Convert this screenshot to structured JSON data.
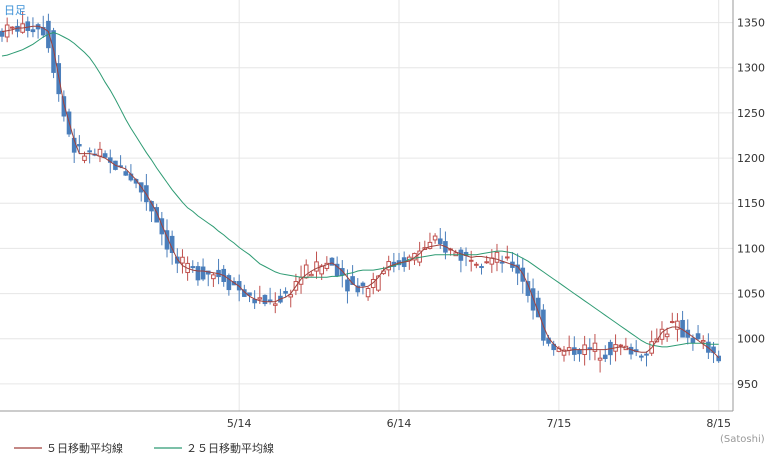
{
  "period_label": "日足",
  "unit_label": "(Satoshi)",
  "colors": {
    "plot_background": "#ffffff",
    "grid": "#e6e6e6",
    "axis": "#999999",
    "label": "#333333",
    "period_label": "#3a8fd6",
    "candle_down": "#4a7ebb",
    "candle_up": "#ffffff",
    "candle_up_outline": "#c0504d",
    "ma5": "#a0413c",
    "ma25": "#2e9b73"
  },
  "chart_data": {
    "type": "candlestick",
    "x_ticks": [
      {
        "label": "5/14",
        "index": 46
      },
      {
        "label": "6/14",
        "index": 77
      },
      {
        "label": "7/15",
        "index": 108
      },
      {
        "label": "8/15",
        "index": 139
      }
    ],
    "y_ticks": [
      950,
      1000,
      1050,
      1100,
      1150,
      1200,
      1250,
      1300,
      1350
    ],
    "ylim": [
      920,
      1375
    ],
    "x_range": [
      0,
      141
    ],
    "legend": [
      {
        "name": "５日移動平均線",
        "color": "#a0413c"
      },
      {
        "name": "２５日移動平均線",
        "color": "#2e9b73"
      }
    ],
    "series": {
      "ma5": [
        1340,
        1341,
        1342,
        1344,
        1344,
        1345,
        1346,
        1346,
        1344,
        1340,
        1320,
        1290,
        1260,
        1240,
        1220,
        1205,
        1205,
        1205,
        1204,
        1202,
        1200,
        1196,
        1192,
        1190,
        1188,
        1182,
        1176,
        1168,
        1160,
        1150,
        1140,
        1126,
        1113,
        1100,
        1088,
        1081,
        1078,
        1076,
        1075,
        1075,
        1074,
        1073,
        1072,
        1070,
        1066,
        1062,
        1058,
        1052,
        1047,
        1044,
        1042,
        1041,
        1041,
        1041,
        1044,
        1046,
        1050,
        1058,
        1066,
        1071,
        1075,
        1078,
        1080,
        1082,
        1084,
        1080,
        1075,
        1068,
        1061,
        1057,
        1057,
        1058,
        1062,
        1068,
        1076,
        1080,
        1082,
        1084,
        1085,
        1086,
        1090,
        1094,
        1100,
        1102,
        1103,
        1104,
        1102,
        1099,
        1096,
        1094,
        1092,
        1090,
        1091,
        1091,
        1090,
        1089,
        1088,
        1086,
        1084,
        1082,
        1080,
        1072,
        1060,
        1045,
        1030,
        1014,
        1001,
        994,
        989,
        986,
        987,
        988,
        988,
        988,
        988,
        988,
        988,
        988,
        989,
        990,
        991,
        990,
        988,
        986,
        985,
        985,
        990,
        998,
        1007,
        1011,
        1013,
        1013,
        1010,
        1006,
        1002,
        998,
        994,
        990,
        985,
        979
      ],
      "ma25": [
        1313,
        1314,
        1316,
        1318,
        1320,
        1323,
        1326,
        1330,
        1334,
        1337,
        1339,
        1337,
        1334,
        1331,
        1327,
        1322,
        1317,
        1311,
        1303,
        1294,
        1284,
        1275,
        1265,
        1254,
        1243,
        1233,
        1224,
        1215,
        1206,
        1198,
        1189,
        1181,
        1173,
        1165,
        1158,
        1151,
        1145,
        1141,
        1136,
        1132,
        1128,
        1124,
        1119,
        1115,
        1110,
        1106,
        1101,
        1097,
        1093,
        1088,
        1083,
        1080,
        1077,
        1074,
        1072,
        1071,
        1070,
        1069,
        1068,
        1068,
        1068,
        1068,
        1068,
        1068,
        1069,
        1069,
        1070,
        1072,
        1073,
        1075,
        1076,
        1076,
        1076,
        1077,
        1078,
        1079,
        1081,
        1083,
        1085,
        1088,
        1089,
        1090,
        1091,
        1092,
        1093,
        1093,
        1093,
        1093,
        1093,
        1093,
        1093,
        1093,
        1093,
        1094,
        1095,
        1096,
        1097,
        1097,
        1096,
        1095,
        1092,
        1089,
        1086,
        1082,
        1078,
        1074,
        1070,
        1066,
        1062,
        1058,
        1054,
        1050,
        1046,
        1042,
        1038,
        1034,
        1030,
        1026,
        1022,
        1018,
        1014,
        1010,
        1006,
        1002,
        998,
        995,
        993,
        992,
        991,
        991,
        992,
        993,
        994,
        995,
        995,
        995,
        995,
        994,
        994,
        994
      ]
    }
  }
}
